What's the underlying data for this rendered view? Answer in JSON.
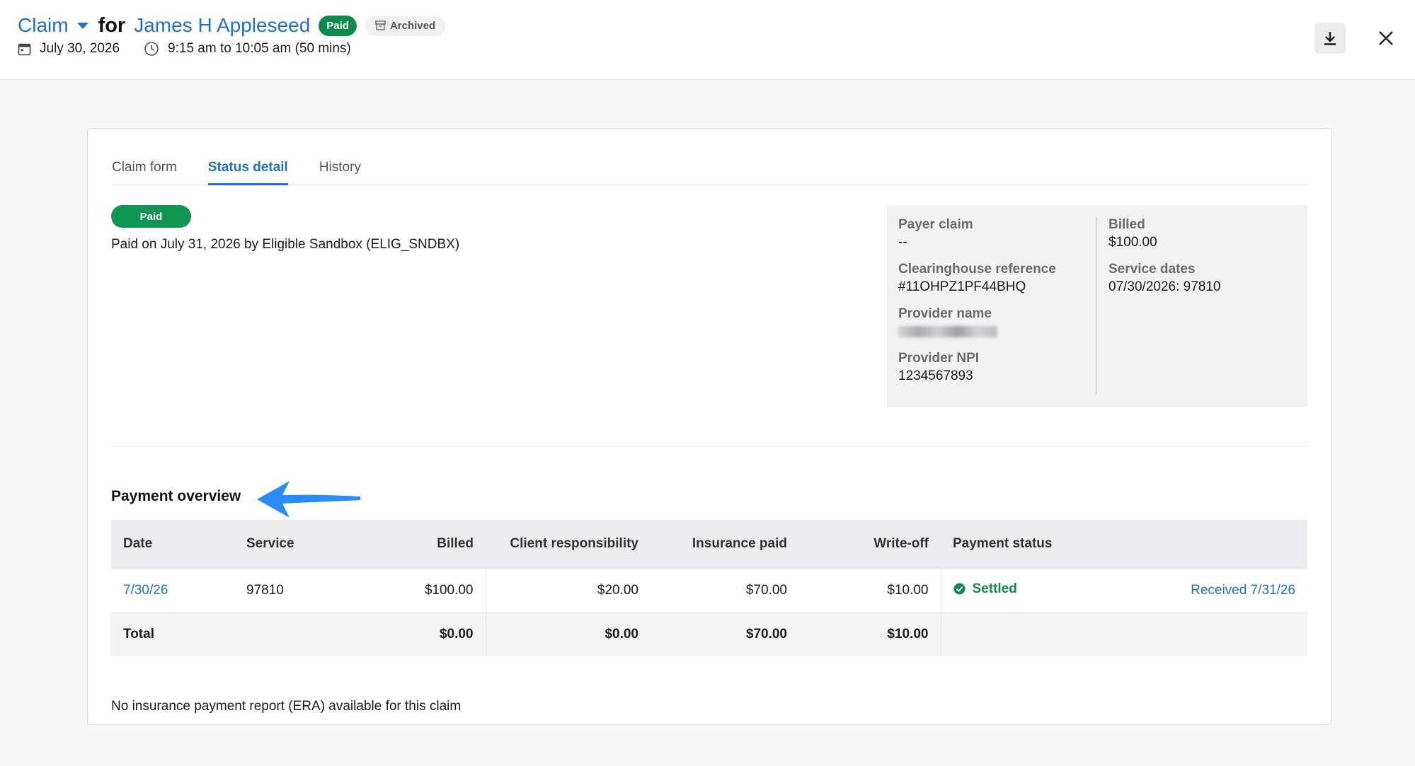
{
  "header": {
    "claim_label": "Claim",
    "for_label": "for",
    "client_name": "James H Appleseed",
    "status_badge": "Paid",
    "archived_badge": "Archived",
    "date": "July 30, 2026",
    "time": "9:15 am to 10:05 am (50 mins)"
  },
  "tabs": [
    {
      "label": "Claim form",
      "active": false
    },
    {
      "label": "Status detail",
      "active": true
    },
    {
      "label": "History",
      "active": false
    }
  ],
  "status": {
    "pill": "Paid",
    "detail": "Paid on July 31, 2026 by Eligible Sandbox (ELIG_SNDBX)"
  },
  "summary": {
    "payer_claim_label": "Payer claim",
    "payer_claim_value": "--",
    "clearinghouse_label": "Clearinghouse reference",
    "clearinghouse_value": "#11OHPZ1PF44BHQ",
    "provider_name_label": "Provider name",
    "provider_npi_label": "Provider NPI",
    "provider_npi_value": "1234567893",
    "billed_label": "Billed",
    "billed_value": "$100.00",
    "service_dates_label": "Service dates",
    "service_dates_value": "07/30/2026: 97810"
  },
  "payment": {
    "title": "Payment overview",
    "columns": [
      "Date",
      "Service",
      "Billed",
      "Client responsibility",
      "Insurance paid",
      "Write-off",
      "Payment status"
    ],
    "rows": [
      {
        "date": "7/30/26",
        "service": "97810",
        "billed": "$100.00",
        "client_responsibility": "$20.00",
        "insurance_paid": "$70.00",
        "write_off": "$10.00",
        "status": "Settled",
        "received": "Received 7/31/26"
      }
    ],
    "total": {
      "label": "Total",
      "billed": "$0.00",
      "client_responsibility": "$0.00",
      "insurance_paid": "$70.00",
      "write_off": "$10.00"
    },
    "no_era": "No insurance payment report (ERA) available for this claim"
  },
  "colors": {
    "accent": "#1f72c4",
    "paid_green": "#0f8a4f",
    "arrow_blue": "#2a8cf7"
  },
  "icons": [
    "calendar-icon",
    "clock-icon",
    "archive-icon",
    "download-icon",
    "close-icon",
    "check-circle-icon",
    "arrow-annotation-icon"
  ]
}
